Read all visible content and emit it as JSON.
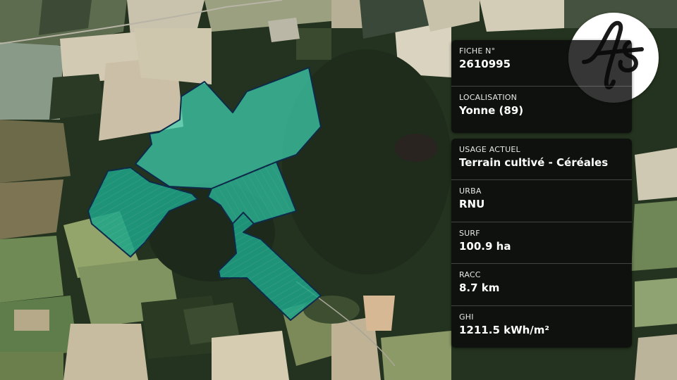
{
  "map": {
    "type": "satellite",
    "parcel_fill": "#3fd1b0",
    "parcel_stroke": "#0d2a4a"
  },
  "logo": {
    "icon": "fs-logo-icon"
  },
  "card1": [
    {
      "label": "FICHE N°",
      "value": "2610995"
    },
    {
      "label": "LOCALISATION",
      "value": "Yonne (89)"
    }
  ],
  "card2": [
    {
      "label": "USAGE ACTUEL",
      "value": "Terrain cultivé - Céréales"
    },
    {
      "label": "URBA",
      "value": "RNU"
    },
    {
      "label": "SURF",
      "value": "100.9 ha"
    },
    {
      "label": "RACC",
      "value": "8.7 km"
    },
    {
      "label": "GHI",
      "value": "1211.5 kWh/m²"
    }
  ]
}
